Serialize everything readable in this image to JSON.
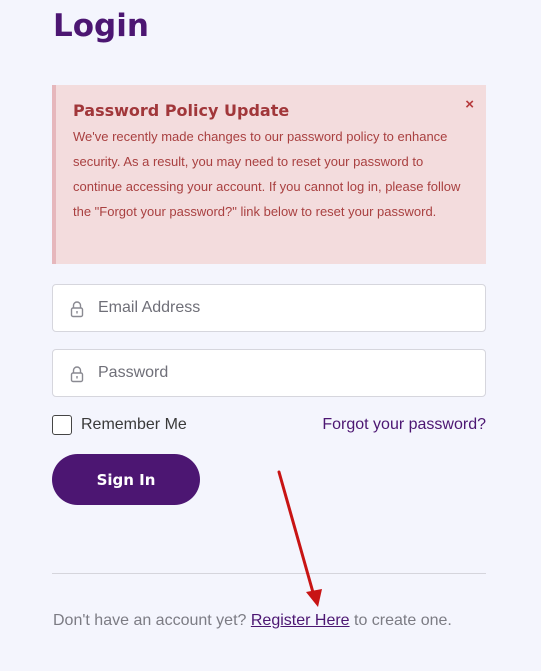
{
  "page": {
    "title": "Login"
  },
  "alert": {
    "title": "Password Policy Update",
    "body": "We've recently made changes to our password policy to enhance security. As a result, you may need to reset your password to continue accessing your account. If you cannot log in, please follow the \"Forgot your password?\" link below to reset your password.",
    "close": "×"
  },
  "form": {
    "email_placeholder": "Email Address",
    "password_placeholder": "Password",
    "remember_label": "Remember Me",
    "remember_checked": false,
    "forgot_link": "Forgot your password?",
    "signin_label": "Sign In"
  },
  "footer": {
    "prefix": "Don't have an account yet? ",
    "register_link": "Register Here",
    "suffix": " to create one."
  },
  "icons": {
    "field_icon": "lock-icon",
    "annotation": "red-arrow"
  },
  "colors": {
    "accent": "#4c1672",
    "alert_bg": "#f3dcdd",
    "alert_text": "#a94040",
    "annotation": "#c81414"
  }
}
